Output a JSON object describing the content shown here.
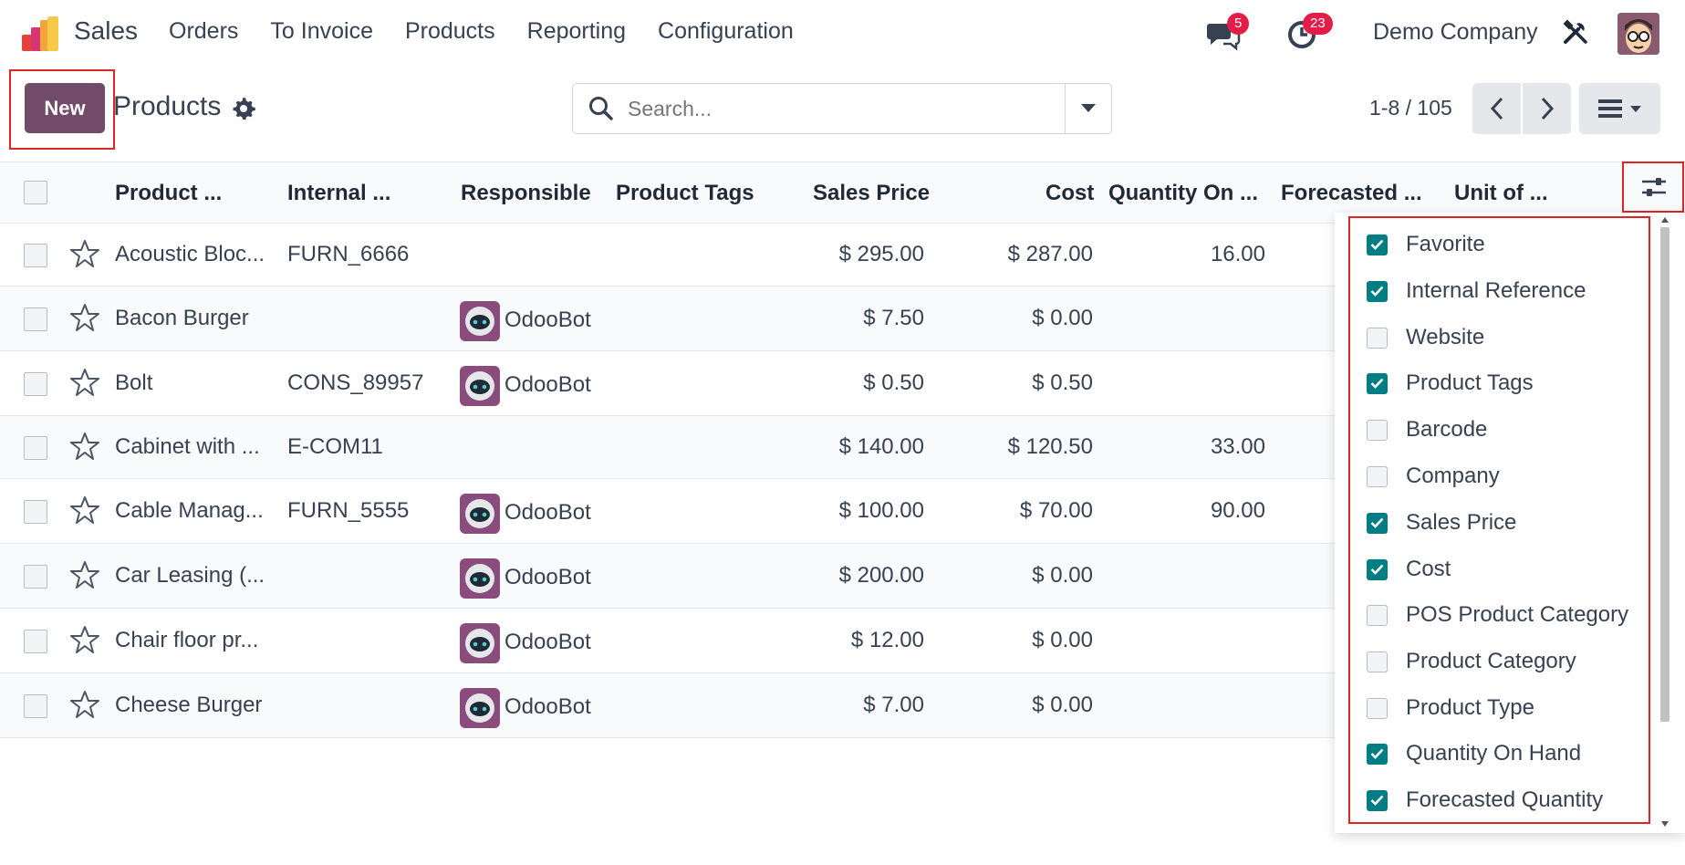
{
  "app": {
    "name": "Sales"
  },
  "menu": [
    "Orders",
    "To Invoice",
    "Products",
    "Reporting",
    "Configuration"
  ],
  "systray": {
    "messages_count": "5",
    "activities_count": "23",
    "company": "Demo Company"
  },
  "control_panel": {
    "new_label": "New",
    "title": "Products",
    "search_placeholder": "Search...",
    "pager": "1-8 / 105"
  },
  "columns": [
    "Product ...",
    "Internal ...",
    "Responsible",
    "Product Tags",
    "Sales Price",
    "Cost",
    "Quantity On ...",
    "Forecasted ...",
    "Unit of ..."
  ],
  "rows": [
    {
      "name": "Acoustic Bloc...",
      "ref": "FURN_6666",
      "responsible": "",
      "price": "$ 295.00",
      "cost": "$ 287.00",
      "qty": "16.00"
    },
    {
      "name": "Bacon Burger",
      "ref": "",
      "responsible": "OdooBot",
      "price": "$ 7.50",
      "cost": "$ 0.00",
      "qty": ""
    },
    {
      "name": "Bolt",
      "ref": "CONS_89957",
      "responsible": "OdooBot",
      "price": "$ 0.50",
      "cost": "$ 0.50",
      "qty": ""
    },
    {
      "name": "Cabinet with ...",
      "ref": "E-COM11",
      "responsible": "",
      "price": "$ 140.00",
      "cost": "$ 120.50",
      "qty": "33.00"
    },
    {
      "name": "Cable Manag...",
      "ref": "FURN_5555",
      "responsible": "OdooBot",
      "price": "$ 100.00",
      "cost": "$ 70.00",
      "qty": "90.00"
    },
    {
      "name": "Car Leasing (...",
      "ref": "",
      "responsible": "OdooBot",
      "price": "$ 200.00",
      "cost": "$ 0.00",
      "qty": ""
    },
    {
      "name": "Chair floor pr...",
      "ref": "",
      "responsible": "OdooBot",
      "price": "$ 12.00",
      "cost": "$ 0.00",
      "qty": ""
    },
    {
      "name": "Cheese Burger",
      "ref": "",
      "responsible": "OdooBot",
      "price": "$ 7.00",
      "cost": "$ 0.00",
      "qty": ""
    }
  ],
  "optional_columns": [
    {
      "label": "Favorite",
      "checked": true
    },
    {
      "label": "Internal Reference",
      "checked": true
    },
    {
      "label": "Website",
      "checked": false
    },
    {
      "label": "Product Tags",
      "checked": true
    },
    {
      "label": "Barcode",
      "checked": false
    },
    {
      "label": "Company",
      "checked": false
    },
    {
      "label": "Sales Price",
      "checked": true
    },
    {
      "label": "Cost",
      "checked": true
    },
    {
      "label": "POS Product Category",
      "checked": false
    },
    {
      "label": "Product Category",
      "checked": false
    },
    {
      "label": "Product Type",
      "checked": false
    },
    {
      "label": "Quantity On Hand",
      "checked": true
    },
    {
      "label": "Forecasted Quantity",
      "checked": true
    }
  ],
  "colors": {
    "brand": "#714b67",
    "checkbox_on": "#017e84",
    "badge": "#e11d48",
    "highlight": "#e02424"
  }
}
